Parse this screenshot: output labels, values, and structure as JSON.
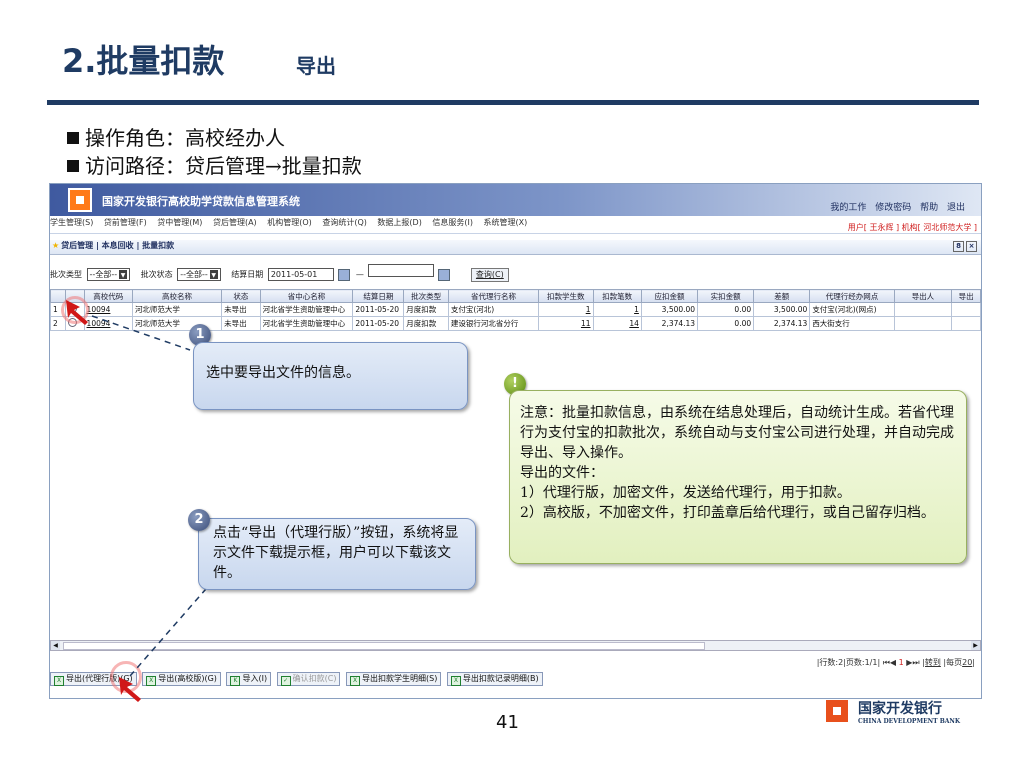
{
  "slide": {
    "title": "2.批量扣款",
    "subtitle": "导出",
    "role_line": "操作角色：高校经办人",
    "path_line": "访问路径：贷后管理→批量扣款",
    "page_number": "41",
    "bank_name_cn": "国家开发银行",
    "bank_name_en": "CHINA DEVELOPMENT BANK"
  },
  "app": {
    "title": "国家开发银行高校助学贷款信息管理系统",
    "top_links": [
      "我的工作",
      "修改密码",
      "帮助",
      "退出"
    ],
    "menu": [
      "学生管理(S)",
      "贷前管理(F)",
      "贷中管理(M)",
      "贷后管理(A)",
      "机构管理(O)",
      "查询统计(Q)",
      "数据上报(D)",
      "信息服务(I)",
      "系统管理(X)"
    ],
    "user_info": "用户[ 王永辉 ]  机构[ 河北师范大学 ]",
    "breadcrumb": "贷后管理 | 本息回收 | 批量扣款",
    "win_buttons": [
      "8",
      "×"
    ]
  },
  "filter": {
    "batch_type_label": "批次类型",
    "batch_type_value": "--全部--",
    "batch_status_label": "批次状态",
    "batch_status_value": "--全部--",
    "settle_date_label": "结算日期",
    "settle_date_from": "2011-05-01",
    "range_sep": "—",
    "settle_date_to": "",
    "query_label": "查询(C)"
  },
  "table": {
    "headers": [
      "",
      "",
      "高校代码",
      "高校名称",
      "状态",
      "省中心名称",
      "结算日期",
      "批次类型",
      "省代理行名称",
      "扣款学生数",
      "扣款笔数",
      "应扣金额",
      "实扣金额",
      "差额",
      "代理行经办网点",
      "导出人",
      "导出"
    ],
    "rows": [
      [
        "1",
        "",
        "10094",
        "河北师范大学",
        "未导出",
        "河北省学生资助管理中心",
        "2011-05-20",
        "月度扣款",
        "支付宝(河北)",
        "1",
        "1",
        "3,500.00",
        "0.00",
        "3,500.00",
        "支付宝(河北)(网点)",
        "",
        ""
      ],
      [
        "2",
        "",
        "10094",
        "河北师范大学",
        "未导出",
        "河北省学生资助管理中心",
        "2011-05-20",
        "月度扣款",
        "建设银行河北省分行",
        "11",
        "14",
        "2,374.13",
        "0.00",
        "2,374.13",
        "西大街支行",
        "",
        ""
      ]
    ]
  },
  "pager": {
    "rows": "|行数:2",
    "pages": "|页数:1/1|",
    "first_prev": "⏮◀",
    "current": "1",
    "next_last": "▶⏭",
    "goto": "|转到",
    "per_page": "|每页",
    "per_page_value": "20",
    "end": "|"
  },
  "buttons": [
    {
      "label": "导出(代理行版)(G)",
      "disabled": false
    },
    {
      "label": "导出(高校版)(G)",
      "disabled": false
    },
    {
      "label": "导入(I)",
      "disabled": false
    },
    {
      "label": "确认扣款(C)",
      "disabled": true
    },
    {
      "label": "导出扣款学生明细(S)",
      "disabled": false
    },
    {
      "label": "导出扣款记录明细(B)",
      "disabled": false
    }
  ],
  "callouts": {
    "step1_marker": "1",
    "step1_text": "选中要导出文件的信息。",
    "step2_marker": "2",
    "step2_text": "点击“导出（代理行版）”按钮，系统将显示文件下载提示框，用户可以下载该文件。",
    "note_marker": "!",
    "note_lines": [
      "注意：批量扣款信息，由系统在结息处理后，自动统计生成。若省代理行为支付宝的扣款批次，系统自动与支付宝公司进行处理，并自动完成导出、导入操作。",
      "导出的文件：",
      "1）代理行版，加密文件，发送给代理行，用于扣款。",
      "2）高校版，不加密文件，打印盖章后给代理行，或自己留存归档。"
    ]
  },
  "colors": {
    "title_blue": "#1f3b63",
    "accent_red": "#d02020",
    "logo_orange": "#e8501c"
  }
}
